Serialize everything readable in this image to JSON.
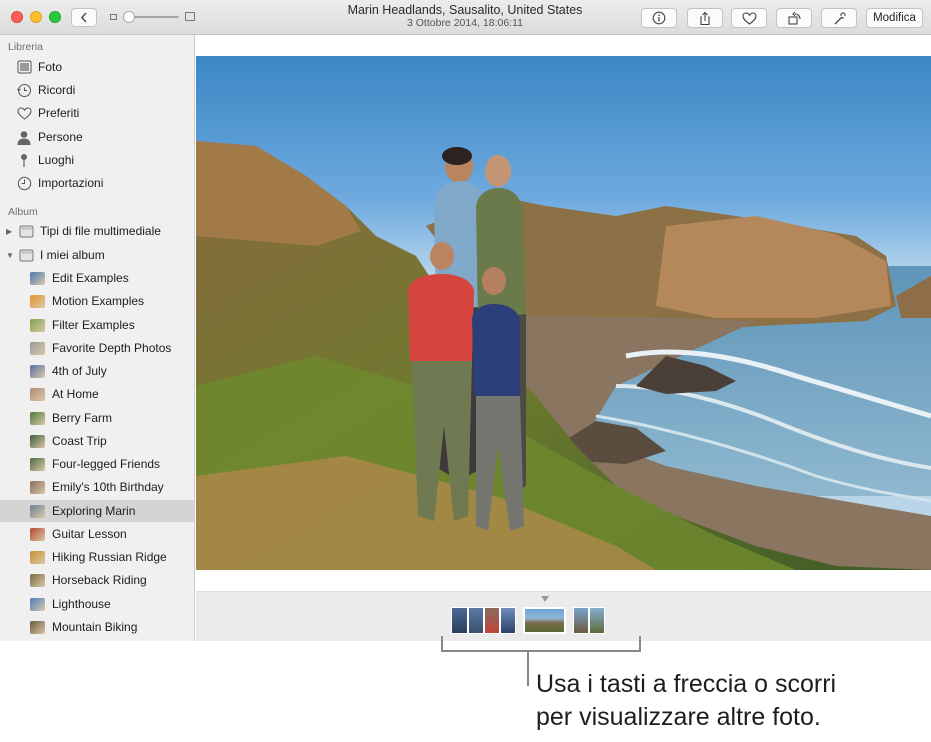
{
  "window": {
    "title": "Marin Headlands, Sausalito, United States",
    "subtitle": "3 Ottobre 2014, 18:06:11",
    "edit_label": "Modifica",
    "toolbar_icons": [
      "info-icon",
      "share-icon",
      "heart-icon",
      "rotate-icon",
      "magic-wand-icon"
    ]
  },
  "sidebar": {
    "library_title": "Libreria",
    "library_items": [
      {
        "label": "Foto",
        "icon": "photos-icon"
      },
      {
        "label": "Ricordi",
        "icon": "memories-icon"
      },
      {
        "label": "Preferiti",
        "icon": "heart-icon"
      },
      {
        "label": "Persone",
        "icon": "person-icon"
      },
      {
        "label": "Luoghi",
        "icon": "pin-icon"
      },
      {
        "label": "Importazioni",
        "icon": "clock-icon"
      }
    ],
    "album_title": "Album",
    "album_groups": [
      {
        "label": "Tipi di file multimediale",
        "expanded": false
      },
      {
        "label": "I miei album",
        "expanded": true
      }
    ],
    "albums": [
      {
        "label": "Edit Examples",
        "color": "#4a78b8"
      },
      {
        "label": "Motion Examples",
        "color": "#e8912f"
      },
      {
        "label": "Filter Examples",
        "color": "#7da34a"
      },
      {
        "label": "Favorite Depth Photos",
        "color": "#9a9a9a"
      },
      {
        "label": "4th of July",
        "color": "#5a6fa8"
      },
      {
        "label": "At Home",
        "color": "#b08a78"
      },
      {
        "label": "Berry Farm",
        "color": "#4c7a3a"
      },
      {
        "label": "Coast Trip",
        "color": "#3d5d38"
      },
      {
        "label": "Four-legged Friends",
        "color": "#4a6b3f"
      },
      {
        "label": "Emily's 10th Birthday",
        "color": "#8a6a5a"
      },
      {
        "label": "Exploring Marin",
        "color": "#6a7f9a",
        "selected": true
      },
      {
        "label": "Guitar Lesson",
        "color": "#b5472f"
      },
      {
        "label": "Hiking Russian Ridge",
        "color": "#c7902e"
      },
      {
        "label": "Horseback Riding",
        "color": "#7a6a45"
      },
      {
        "label": "Lighthouse",
        "color": "#4b7cc0"
      },
      {
        "label": "Mountain Biking",
        "color": "#6c5a3a"
      }
    ]
  },
  "callout": {
    "line1": "Usa i tasti a freccia o scorri",
    "line2": "per visualizzare altre foto."
  }
}
